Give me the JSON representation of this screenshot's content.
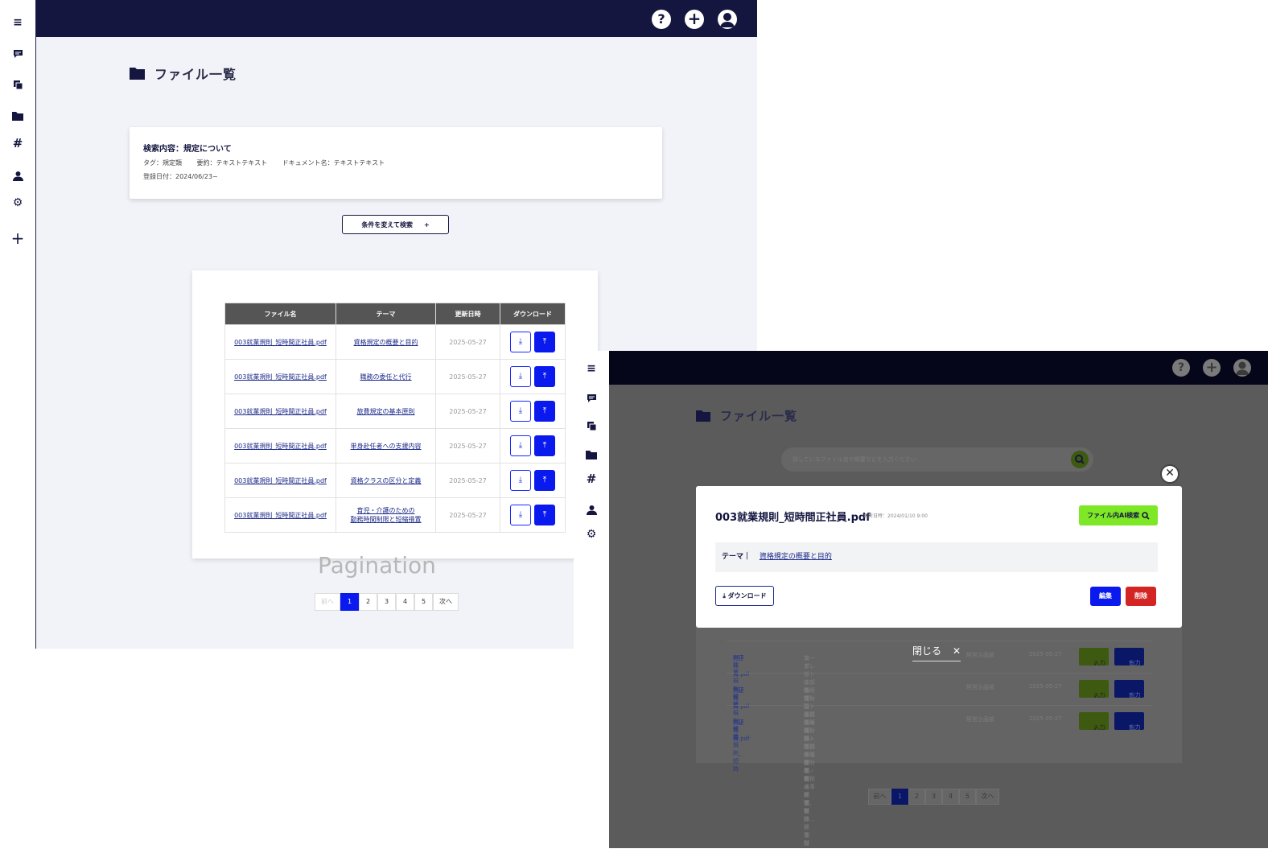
{
  "colors": {
    "navy": "#14163f",
    "primary_blue": "#0a1aef",
    "accent_green": "#7ee826",
    "danger_red": "#d42525"
  },
  "sidebar": {
    "items": [
      {
        "icon": "menu-icon"
      },
      {
        "icon": "chat-icon"
      },
      {
        "icon": "copy-icon"
      },
      {
        "icon": "folder-icon"
      },
      {
        "icon": "hashtag-icon"
      },
      {
        "icon": "user-icon"
      },
      {
        "icon": "gear-icon"
      },
      {
        "icon": "plus-icon"
      }
    ]
  },
  "topbar": {
    "help_glyph": "?",
    "add_glyph": "+",
    "account_icon": "account-icon"
  },
  "page": {
    "title": "ファイル一覧"
  },
  "search_summary": {
    "query": "検索内容：規定について",
    "tag": "タグ：規定類",
    "summary": "要約：テキストテキスト",
    "document": "ドキュメント名：テキストテキスト",
    "date": "登録日付：2024/06/23~"
  },
  "change_search_button": {
    "label": "条件を変えて検索",
    "glyph": "+"
  },
  "file_table": {
    "headers": [
      "ファイル名",
      "テーマ",
      "更新日時",
      "ダウンロード"
    ],
    "rows": [
      {
        "file": "003就業規則_短時間正社員.pdf",
        "theme": [
          "資格規定の概要と目的"
        ],
        "date": "2025-05-27"
      },
      {
        "file": "003就業規則_短時間正社員.pdf",
        "theme": [
          "職務の委任と代行"
        ],
        "date": "2025-05-27"
      },
      {
        "file": "003就業規則_短時間正社員.pdf",
        "theme": [
          "旅費規定の基本原則"
        ],
        "date": "2025-05-27"
      },
      {
        "file": "003就業規則_短時間正社員.pdf",
        "theme": [
          "単身赴任者への支援内容"
        ],
        "date": "2025-05-27"
      },
      {
        "file": "003就業規則_短時間正社員.pdf",
        "theme": [
          "資格クラスの区分と定義"
        ],
        "date": "2025-05-27"
      },
      {
        "file": "003就業規則_短時間正社員.pdf",
        "theme": [
          "育児・介護のための",
          "勤務時間制限と短縮措置"
        ],
        "date": "2025-05-27"
      }
    ]
  },
  "pagination": {
    "heading": "Pagination",
    "prev": "前へ",
    "pages": [
      "1",
      "2",
      "3",
      "4",
      "5"
    ],
    "current": "1",
    "next": "次へ"
  },
  "modal_screen": {
    "search_placeholder": "探しているファイル名や概要などを入力ください",
    "modal": {
      "file_name": "003就業規則_短時間正社員.pdf",
      "updated": "更新日時：2024/01/10 9:00",
      "ai_search_label": "ファイル内AI検索",
      "theme_label": "テーマ｜",
      "theme_value": "資格規定の概要と目的",
      "download_label": "ダウンロード",
      "edit_label": "編集",
      "delete_label": "削除"
    },
    "close_label": "閉じる",
    "close_glyph": "✕",
    "background_rows": [
      {
        "file": [
          "003就業規則_短時",
          "間正社員.pdf"
        ],
        "desc": [
          "コーポレート本部は経理財務・労務人事業務、営",
          "業本部は販売管理コーポレート本部は経理財務..."
        ],
        "category": "経営企画部",
        "date": "2025-05-27",
        "in_label": "入力",
        "out_label": "出力"
      },
      {
        "file": [
          "003就業規則_短時",
          "間正社員.pdf"
        ],
        "desc": [
          "コーポレート本部は経理財務・労務人事業務、営",
          "業本部は販売管理コーポレート本部は経理財務..."
        ],
        "category": "経営企画部",
        "date": "2025-05-27",
        "in_label": "入力",
        "out_label": "出力"
      },
      {
        "file": [
          "003就業規則_短時",
          "間正社員.pdf"
        ],
        "desc": [
          "コーポレート本部は経理財務・労務人事業務、営",
          "業本部は販売管理コーポレート本部は経理財務..."
        ],
        "category": "経営企画部",
        "date": "2025-05-27",
        "in_label": "入力",
        "out_label": "出力"
      }
    ]
  }
}
